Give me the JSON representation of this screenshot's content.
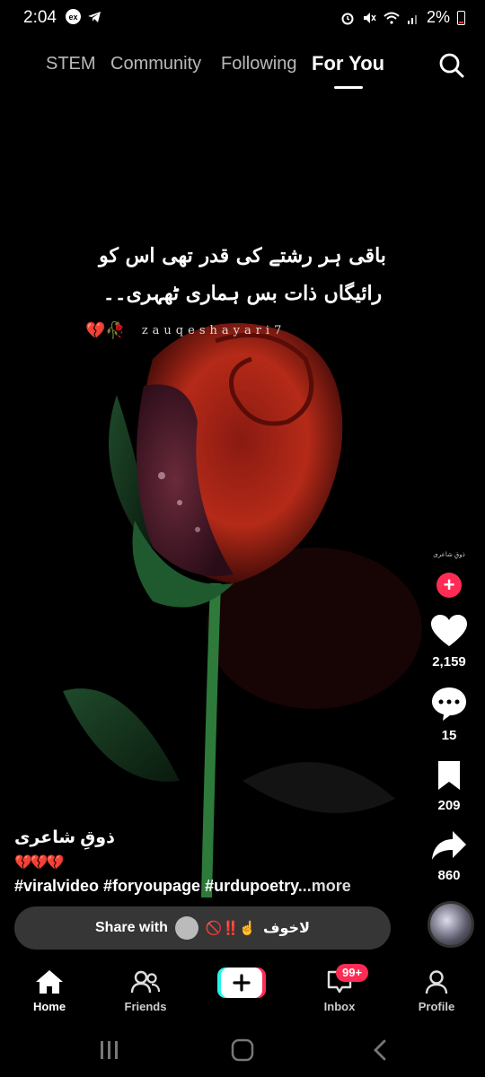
{
  "status_bar": {
    "time": "2:04",
    "ex_badge": "ex",
    "battery": "2%"
  },
  "tabs": [
    {
      "label": "STEM"
    },
    {
      "label": "Community"
    },
    {
      "label": "Following"
    },
    {
      "label": "For You",
      "active": true
    }
  ],
  "video": {
    "poetry_lines": [
      "باقی ہر رشتے کی قدر تھی اس کو",
      "رائیگاں ذات بس ہماری ٹھہری۔۔"
    ],
    "watermark": "zauqeshayari7",
    "watermark_icons": "💔🥀",
    "subject": "red rose on black background"
  },
  "right_rail": {
    "avatar_text": "ذوقِ شاعری",
    "likes": "2,159",
    "comments": "15",
    "saves": "209",
    "shares": "860"
  },
  "caption": {
    "username": "ذوقِ شاعری",
    "emojis": "💔💔💔",
    "hashtags": "#viralvideo #foryoupage #urdupoetry",
    "more": "...more"
  },
  "share_bar": {
    "label": "Share with",
    "name": "لاخوف",
    "emojis": "🚫‼️☝️"
  },
  "bottom_nav": [
    {
      "label": "Home",
      "active": true
    },
    {
      "label": "Friends"
    },
    {
      "label": ""
    },
    {
      "label": "Inbox",
      "badge": "99+"
    },
    {
      "label": "Profile"
    }
  ],
  "colors": {
    "accent": "#fe2c55",
    "background": "#000000"
  }
}
